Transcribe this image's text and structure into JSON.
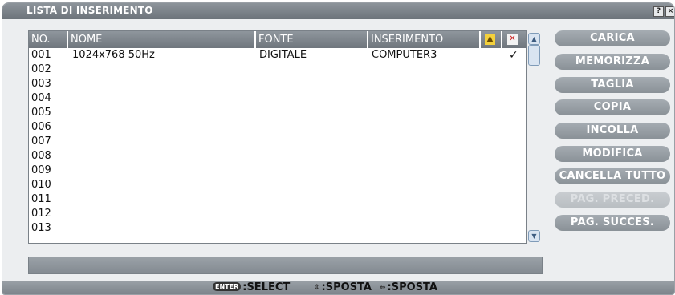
{
  "window": {
    "title": "LISTA DI INSERIMENTO",
    "help_label": "?",
    "close_label": "×"
  },
  "table": {
    "columns": [
      "NO.",
      "NOME",
      "FONTE",
      "INSERIMENTO"
    ],
    "lock_icon": "lock-icon",
    "skip_icon": "skip-icon",
    "rows": [
      {
        "no": "001",
        "nome": "1024x768 50Hz",
        "fonte": "DIGITALE",
        "inserimento": "COMPUTER3",
        "check": "✓"
      },
      {
        "no": "002"
      },
      {
        "no": "003"
      },
      {
        "no": "004"
      },
      {
        "no": "005"
      },
      {
        "no": "006"
      },
      {
        "no": "007"
      },
      {
        "no": "008"
      },
      {
        "no": "009"
      },
      {
        "no": "010"
      },
      {
        "no": "011"
      },
      {
        "no": "012"
      },
      {
        "no": "013"
      }
    ]
  },
  "buttons": [
    {
      "label": "CARICA",
      "enabled": true
    },
    {
      "label": "MEMORIZZA",
      "enabled": true
    },
    {
      "label": "TAGLIA",
      "enabled": true
    },
    {
      "label": "COPIA",
      "enabled": true
    },
    {
      "label": "INCOLLA",
      "enabled": true
    },
    {
      "label": "MODIFICA",
      "enabled": true
    },
    {
      "label": "CANCELLA TUTTO",
      "enabled": true
    },
    {
      "label": "PAG. PRECED.",
      "enabled": false
    },
    {
      "label": "PAG. SUCCES.",
      "enabled": true
    }
  ],
  "status_text": "",
  "footer": {
    "enter_key": "ENTER",
    "select_label": ":SELECT",
    "updown_label": ":SPOSTA",
    "leftright_label": ":SPOSTA"
  }
}
